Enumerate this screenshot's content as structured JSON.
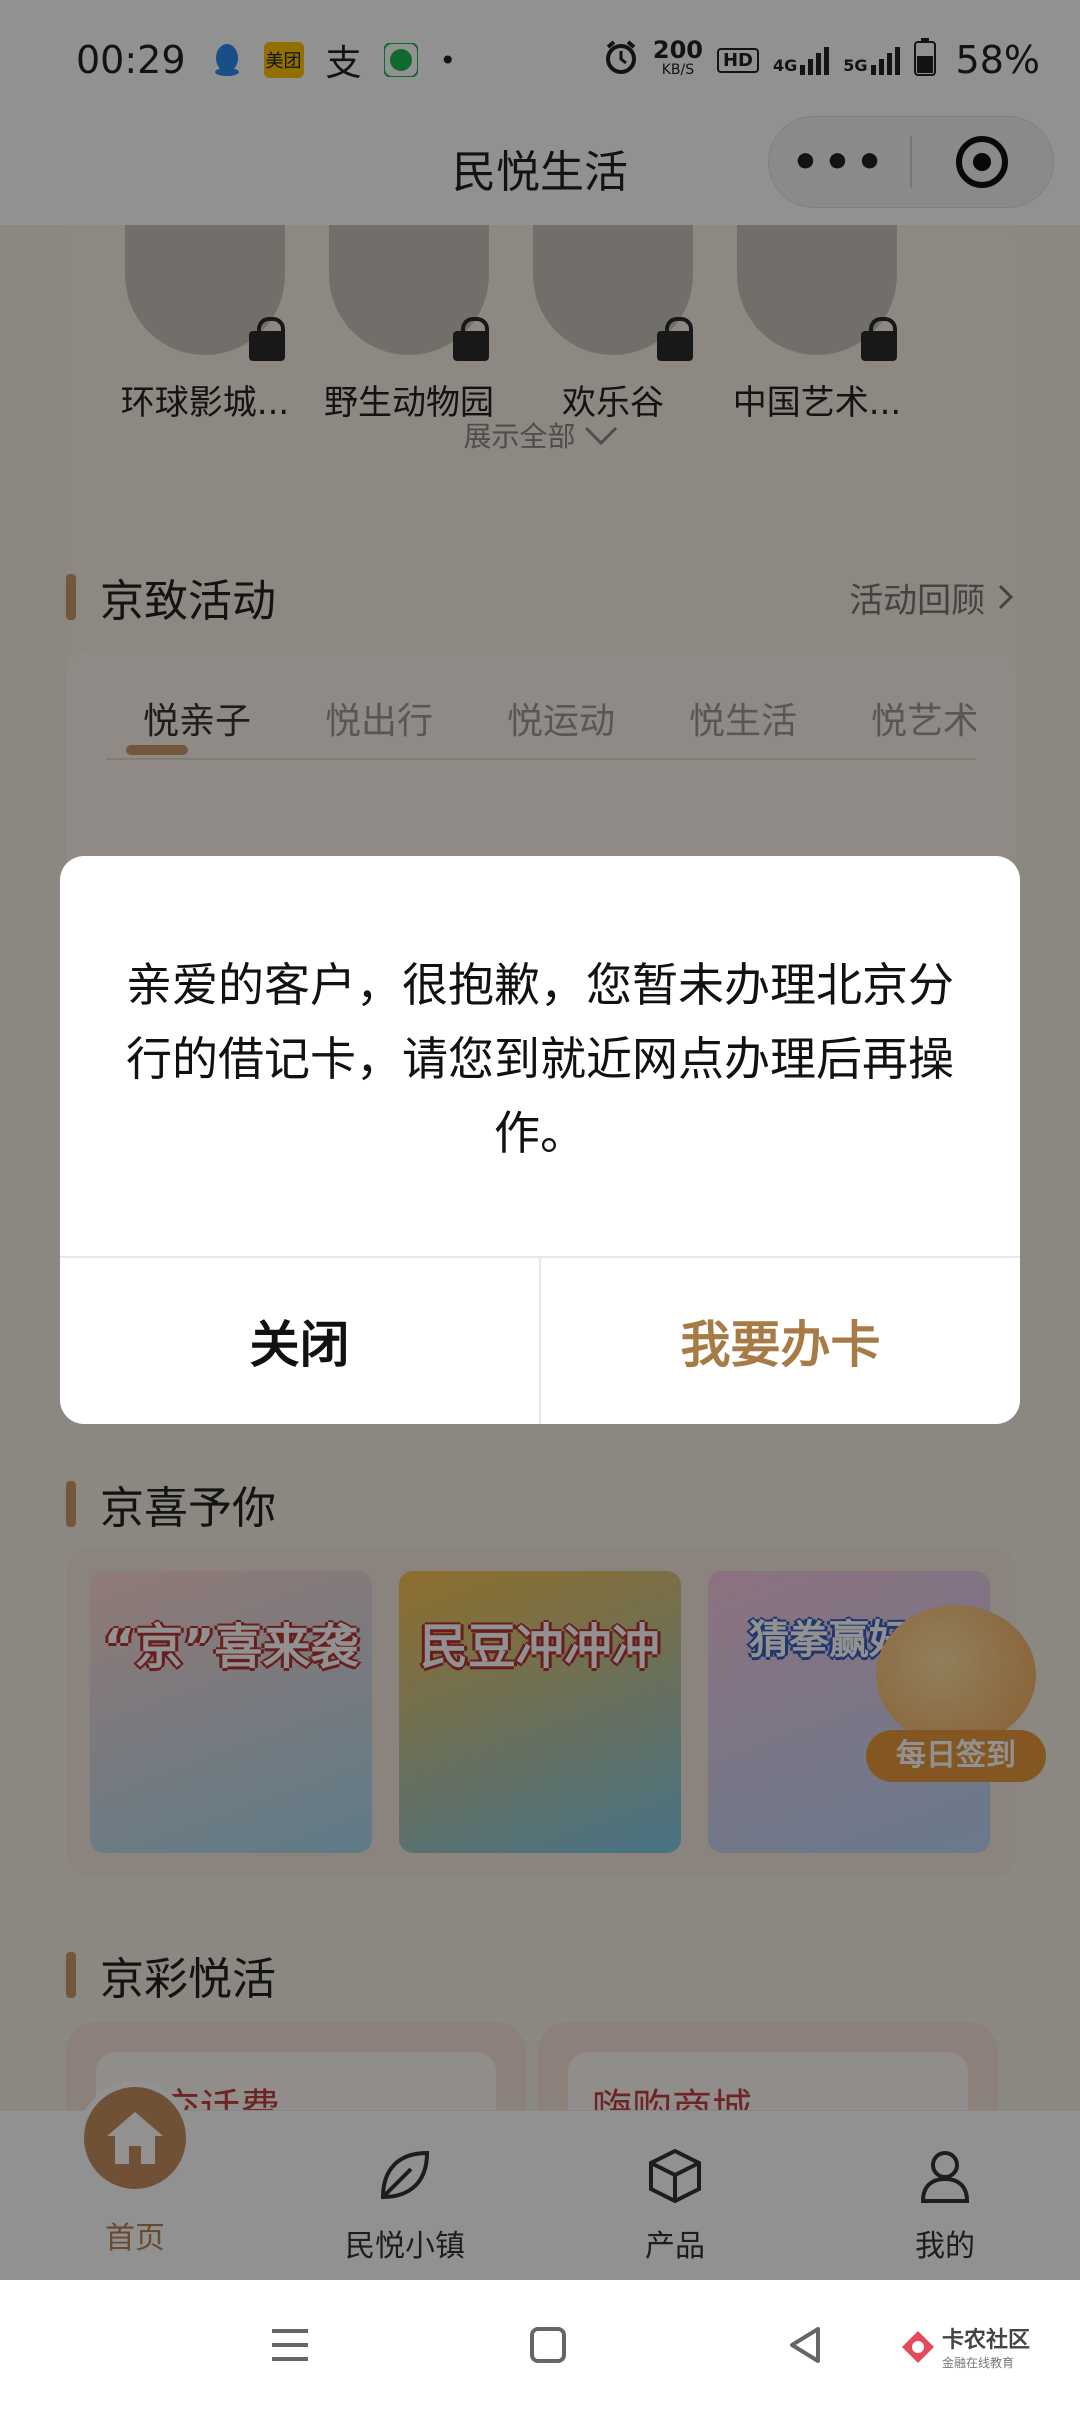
{
  "status_bar": {
    "time": "00:29",
    "app_icons": [
      "qq-icon",
      "meituan-icon",
      "alipay-icon",
      "spotify-icon"
    ],
    "meituan_label": "美团",
    "alipay_glyph": "支",
    "dot": "•",
    "network_speed": "200",
    "network_unit": "KB/S",
    "hd_label": "HD",
    "signal1": "4G",
    "signal2": "5G",
    "battery": "58%"
  },
  "header": {
    "title": "民悦生活",
    "menu_dots": "•••"
  },
  "venues": {
    "items": [
      {
        "label": "环球影城..."
      },
      {
        "label": "野生动物园"
      },
      {
        "label": "欢乐谷"
      },
      {
        "label": "中国艺术..."
      }
    ],
    "expand_label": "展示全部"
  },
  "activities": {
    "title": "京致活动",
    "more_label": "活动回顾",
    "tabs": [
      {
        "label": "悦亲子"
      },
      {
        "label": "悦出行"
      },
      {
        "label": "悦运动"
      },
      {
        "label": "悦生活"
      },
      {
        "label": "悦艺术"
      }
    ],
    "active_tab": 0
  },
  "gifts": {
    "title": "京喜予你",
    "items": [
      {
        "label": "“京”喜来袭"
      },
      {
        "label": "民豆冲冲冲"
      },
      {
        "label": "猜拳赢好礼"
      }
    ],
    "signin_label": "每日签到"
  },
  "life": {
    "title": "京彩悦活",
    "cards": [
      {
        "label": "聚交话费"
      },
      {
        "label": "嗨购商城"
      }
    ]
  },
  "tabbar": {
    "items": [
      {
        "label": "首页",
        "icon": "home-icon"
      },
      {
        "label": "民悦小镇",
        "icon": "leaf-icon"
      },
      {
        "label": "产品",
        "icon": "box-icon"
      },
      {
        "label": "我的",
        "icon": "person-icon"
      }
    ],
    "active": 0
  },
  "dialog": {
    "message": "亲爱的客户，很抱歉，您暂未办理北京分行的借记卡，请您到就近网点办理后再操作。",
    "close_label": "关闭",
    "confirm_label": "我要办卡"
  },
  "watermark": {
    "name": "卡农社区",
    "sub": "金融在线教育"
  },
  "colors": {
    "accent": "#c89a6a",
    "confirm_text": "#a67b45",
    "overlay": "rgba(0,0,0,0.43)"
  }
}
